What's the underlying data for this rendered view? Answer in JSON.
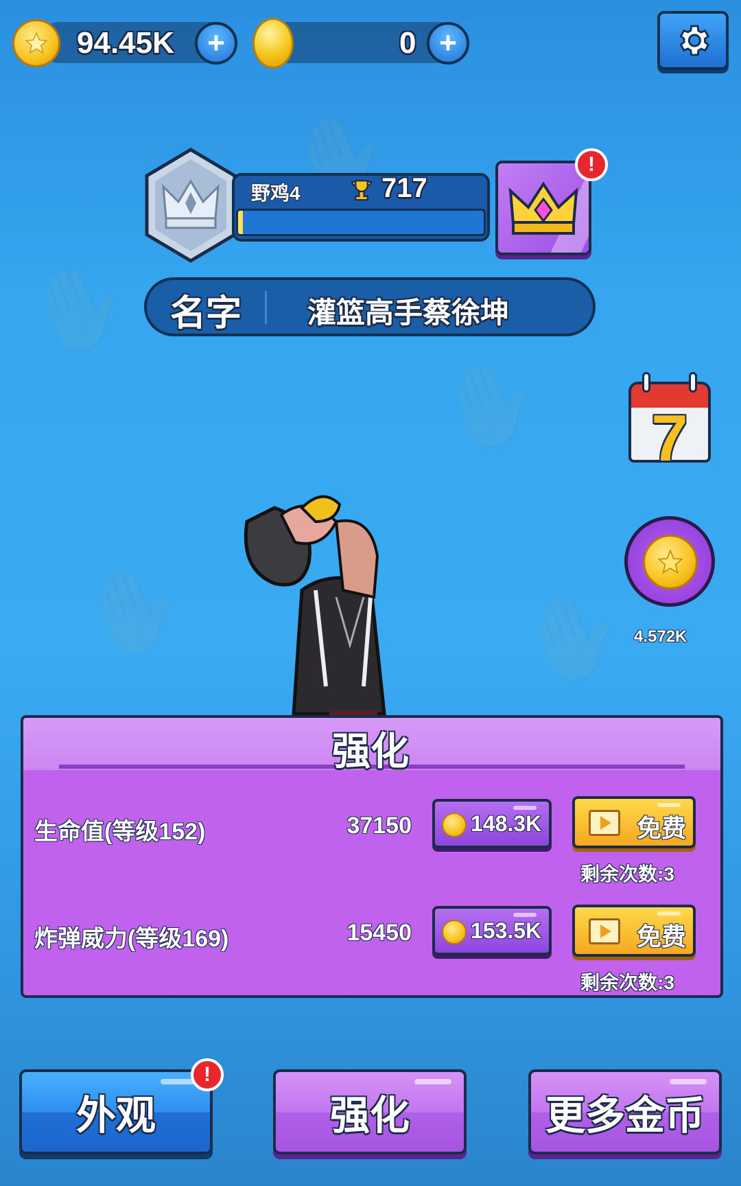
{
  "top_bar": {
    "gold_amount": "94.45K",
    "gem_amount": "0"
  },
  "rank": {
    "rank_name": "野鸡4",
    "trophies": "717",
    "progress": 0.02
  },
  "name_bar": {
    "label": "名字",
    "player_name": "灌篮高手蔡徐坤"
  },
  "side": {
    "calendar_day": "7",
    "coin_bonus": "4.572K"
  },
  "upgrade_panel": {
    "title": "强化",
    "rows": [
      {
        "label": "生命值(等级152)",
        "value": "37150",
        "cost": "148.3K",
        "free_label": "免费",
        "remaining": "剩余次数:3"
      },
      {
        "label": "炸弹威力(等级169)",
        "value": "15450",
        "cost": "153.5K",
        "free_label": "免费",
        "remaining": "剩余次数:3"
      }
    ]
  },
  "bottom_nav": {
    "appearance": "外观",
    "upgrade": "强化",
    "more_coins": "更多金币"
  },
  "alert_mark": "!",
  "colors": {
    "background": "#36a6f0",
    "panel": "#c062ee",
    "gold": "#f7c21c",
    "alert": "#e8262e"
  }
}
